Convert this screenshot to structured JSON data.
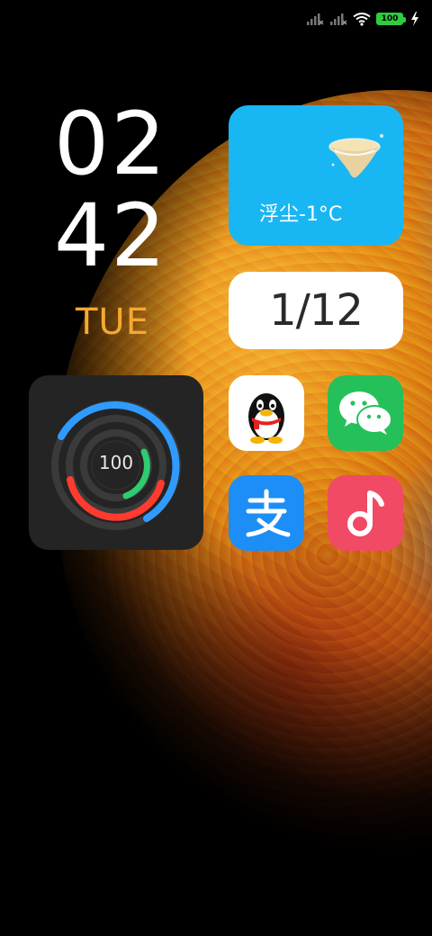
{
  "status_bar": {
    "signal_1_icon": "signal-no-service-icon",
    "signal_2_icon": "signal-no-service-icon",
    "wifi_icon": "wifi-icon",
    "battery_level": "100",
    "charging_icon": "lightning-icon",
    "battery_color": "#2ecc40"
  },
  "clock": {
    "hour": "02",
    "minute": "42",
    "weekday": "TUE",
    "weekday_color": "#f5a830"
  },
  "weather_widget": {
    "text": "浮尘-1°C",
    "icon": "dust-weather-icon",
    "background_color": "#19b6f4"
  },
  "date_widget": {
    "text": "1/12"
  },
  "battery_widget": {
    "value": "100",
    "rings": [
      {
        "name": "outer",
        "color": "#2f9bff"
      },
      {
        "name": "middle",
        "color": "#ff3b30"
      },
      {
        "name": "inner",
        "color": "#2ecc71"
      }
    ]
  },
  "apps": [
    {
      "name": "qq",
      "icon": "qq-penguin-icon",
      "color": "#ffffff"
    },
    {
      "name": "wechat",
      "icon": "wechat-icon",
      "color": "#25c05a"
    },
    {
      "name": "alipay",
      "icon": "alipay-icon",
      "color": "#1c8ef5"
    },
    {
      "name": "music",
      "icon": "music-note-icon",
      "color": "#f14a64"
    }
  ]
}
